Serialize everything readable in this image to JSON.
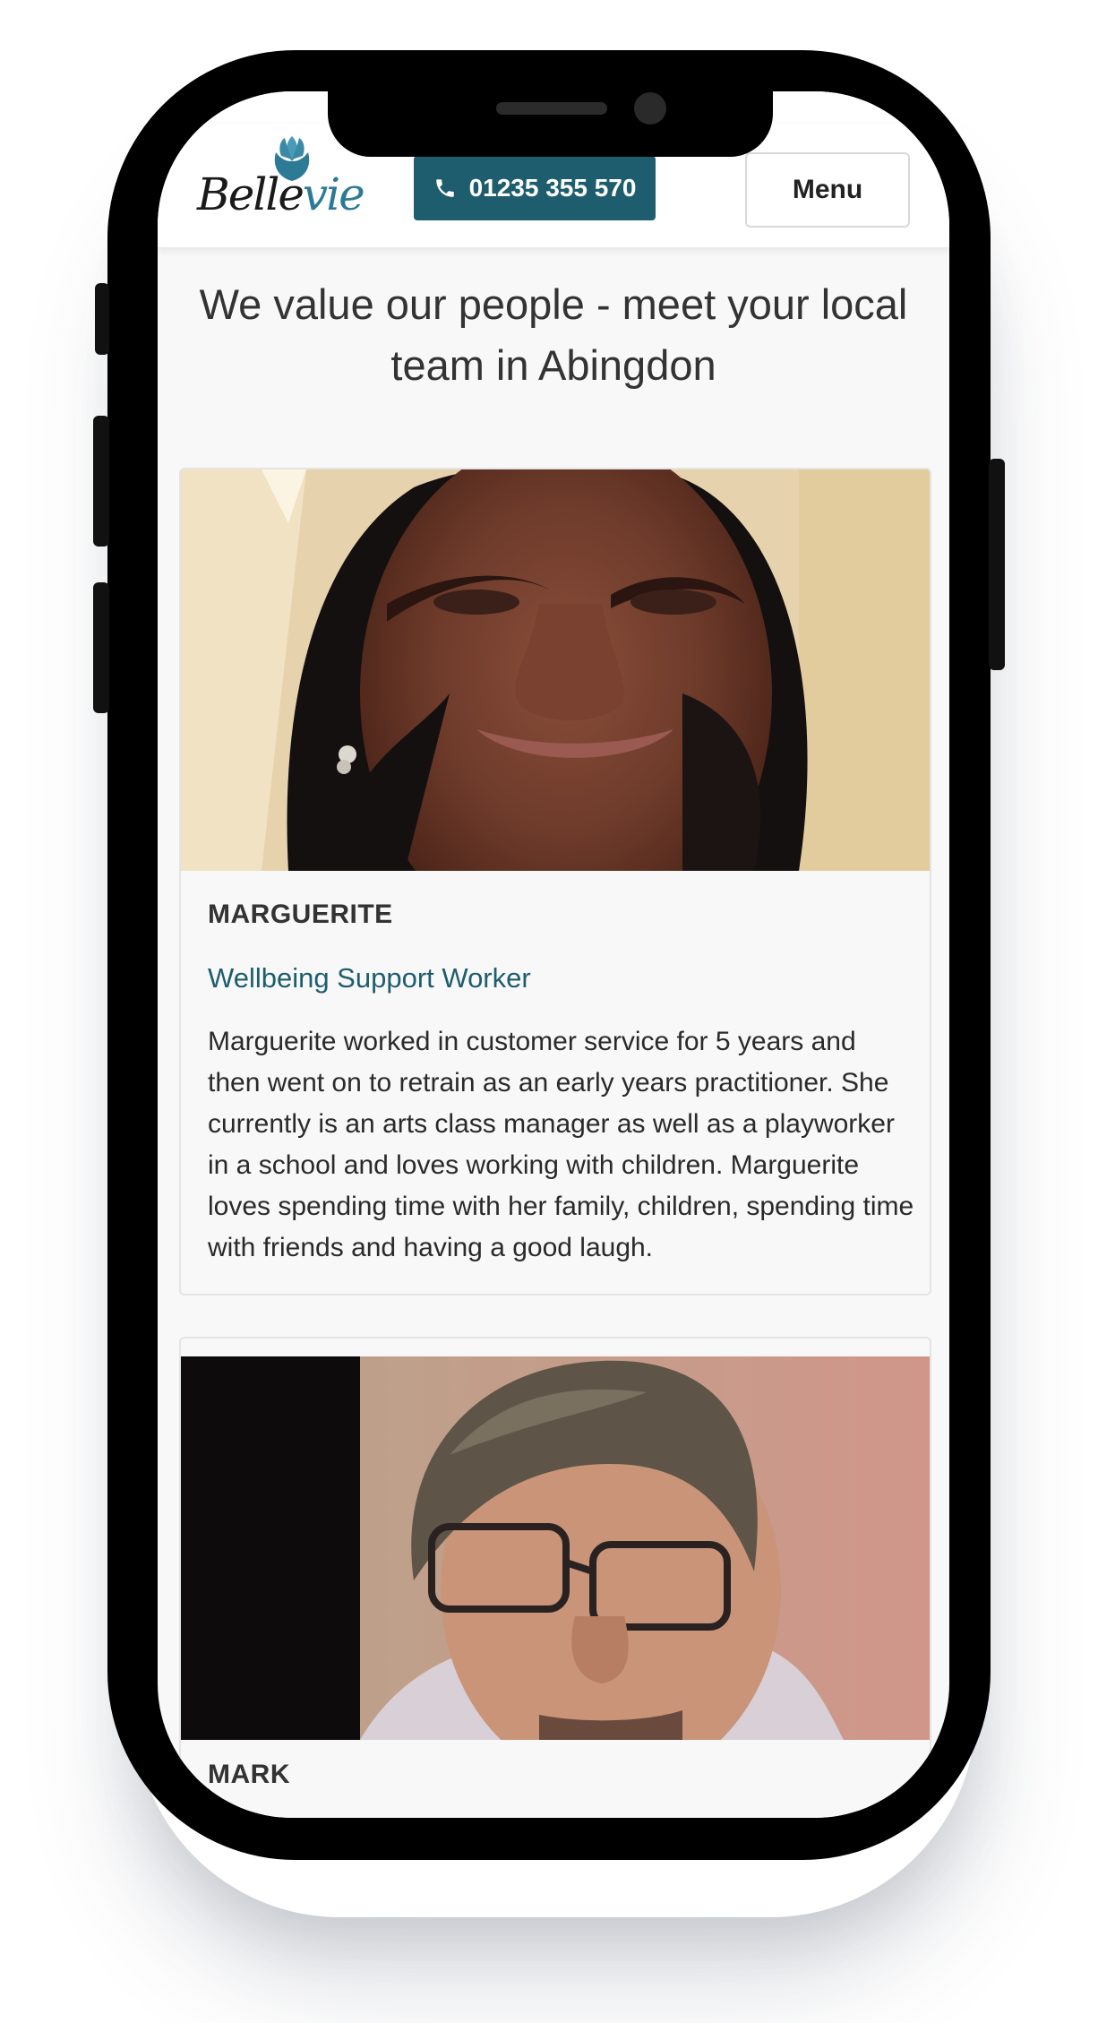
{
  "header": {
    "logo_alt": "Bellevie",
    "logo_prefix": "Belle",
    "logo_suffix": "vie",
    "phone_label": "01235 355 570",
    "menu_label": "Menu"
  },
  "page": {
    "title": "We value our people - meet your local team in Abingdon"
  },
  "team": [
    {
      "name": "MARGUERITE",
      "role": "Wellbeing Support Worker",
      "bio": "Marguerite worked in customer service for 5 years and then went on to retrain as an early years practitioner. She currently is an arts class manager as well as a playworker in a school and loves working with children. Marguerite loves spending time with her family, children, spending time with friends and having a good laugh."
    },
    {
      "name": "MARK"
    }
  ],
  "colors": {
    "brand": "#1e5d6e",
    "accent": "#2d7a96",
    "text": "#333333"
  },
  "icons": {
    "phone": "phone-icon",
    "logo_flower": "tulip-icon"
  }
}
